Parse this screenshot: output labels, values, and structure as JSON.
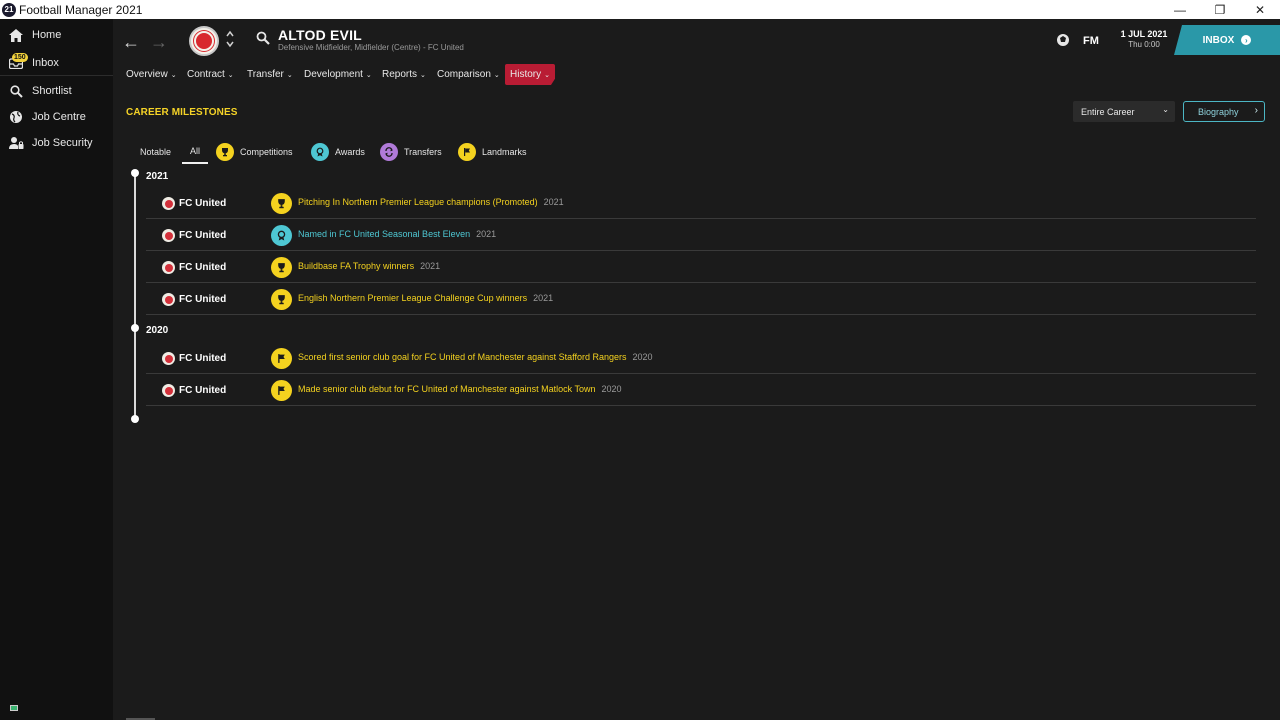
{
  "window": {
    "title": "Football Manager 2021",
    "logo_text": "21",
    "min": "—",
    "restore": "❐",
    "close": "✕"
  },
  "sidebar": {
    "inbox_badge": "150",
    "items": [
      {
        "label": "Home",
        "icon": "home-icon"
      },
      {
        "label": "Inbox",
        "icon": "inbox-icon"
      },
      {
        "label": "Shortlist",
        "icon": "search-icon"
      },
      {
        "label": "Job Centre",
        "icon": "globe-icon"
      },
      {
        "label": "Job Security",
        "icon": "person-lock-icon"
      }
    ]
  },
  "header": {
    "back": "←",
    "forward": "→",
    "player_name": "ALTOD EVIL",
    "player_subtitle": "Defensive Midfielder, Midfielder (Centre) - FC United",
    "fm_label": "FM",
    "date": "1 JUL 2021",
    "day_time": "Thu 0:00",
    "inbox_label": "INBOX",
    "inbox_arrow": "›"
  },
  "menu": {
    "items": [
      {
        "label": "Overview"
      },
      {
        "label": "Contract"
      },
      {
        "label": "Transfer"
      },
      {
        "label": "Development"
      },
      {
        "label": "Reports"
      },
      {
        "label": "Comparison"
      },
      {
        "label": "History",
        "active": true
      }
    ],
    "chevron": "⌄"
  },
  "page": {
    "title": "CAREER MILESTONES",
    "scope_select": "Entire Career",
    "select_chevron": "⌄",
    "biography_button": "Biography",
    "biography_arrow": "›"
  },
  "filters": [
    {
      "label": "Notable"
    },
    {
      "label": "All",
      "active": true
    },
    {
      "label": "Competitions",
      "icon": "trophy-icon"
    },
    {
      "label": "Awards",
      "icon": "award-icon"
    },
    {
      "label": "Transfers",
      "icon": "transfer-icon"
    },
    {
      "label": "Landmarks",
      "icon": "flag-icon"
    }
  ],
  "timeline": [
    {
      "year": "2021",
      "events": [
        {
          "club": "FC United",
          "type": "competition",
          "text": "Pitching In Northern Premier League champions (Promoted)",
          "year": "2021",
          "color": "#f4d21f"
        },
        {
          "club": "FC United",
          "type": "award",
          "text": "Named in FC United Seasonal Best Eleven",
          "year": "2021",
          "color": "#4ec7d3"
        },
        {
          "club": "FC United",
          "type": "competition",
          "text": "Buildbase FA Trophy winners",
          "year": "2021",
          "color": "#f4d21f"
        },
        {
          "club": "FC United",
          "type": "competition",
          "text": "English Northern Premier League Challenge Cup winners",
          "year": "2021",
          "color": "#f4d21f"
        }
      ]
    },
    {
      "year": "2020",
      "events": [
        {
          "club": "FC United",
          "type": "landmark",
          "text": "Scored first senior club goal for FC United of Manchester against Stafford Rangers",
          "year": "2020",
          "color": "#f4d21f"
        },
        {
          "club": "FC United",
          "type": "landmark",
          "text": "Made senior club debut for FC United of Manchester against Matlock Town",
          "year": "2020",
          "color": "#f4d21f"
        }
      ]
    }
  ],
  "colors": {
    "accent_yellow": "#f5d327",
    "history_red": "#b91c34",
    "inbox_teal": "#2a98a8",
    "award_teal": "#4ec7d3",
    "transfer_purple": "#b07ad8"
  }
}
